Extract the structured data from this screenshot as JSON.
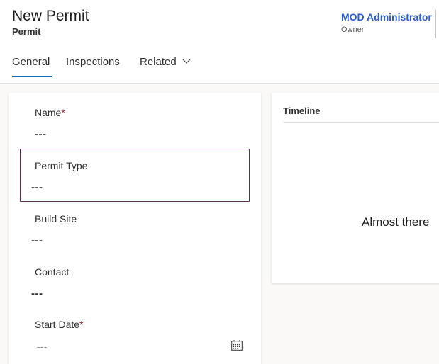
{
  "header": {
    "title": "New Permit",
    "subtitle": "Permit",
    "owner": {
      "name": "MOD Administrator",
      "label": "Owner"
    }
  },
  "tabs": [
    {
      "label": "General",
      "selected": true
    },
    {
      "label": "Inspections",
      "selected": false
    },
    {
      "label": "Related",
      "selected": false
    }
  ],
  "form": {
    "fields": [
      {
        "label": "Name",
        "required": true,
        "value": "---"
      },
      {
        "label": "Permit Type",
        "required": false,
        "value": "---"
      },
      {
        "label": "Build Site",
        "required": false,
        "value": "---"
      },
      {
        "label": "Contact",
        "required": false,
        "value": "---"
      },
      {
        "label": "Start Date",
        "required": true,
        "value": "---"
      }
    ],
    "required_marker": "*"
  },
  "timeline": {
    "title": "Timeline",
    "message": "Almost there"
  },
  "colors": {
    "owner_link": "#2b5bd7",
    "tab_indicator": "#0f6cbd",
    "required": "#a4262c",
    "focus_border": "#5c2e5f"
  }
}
